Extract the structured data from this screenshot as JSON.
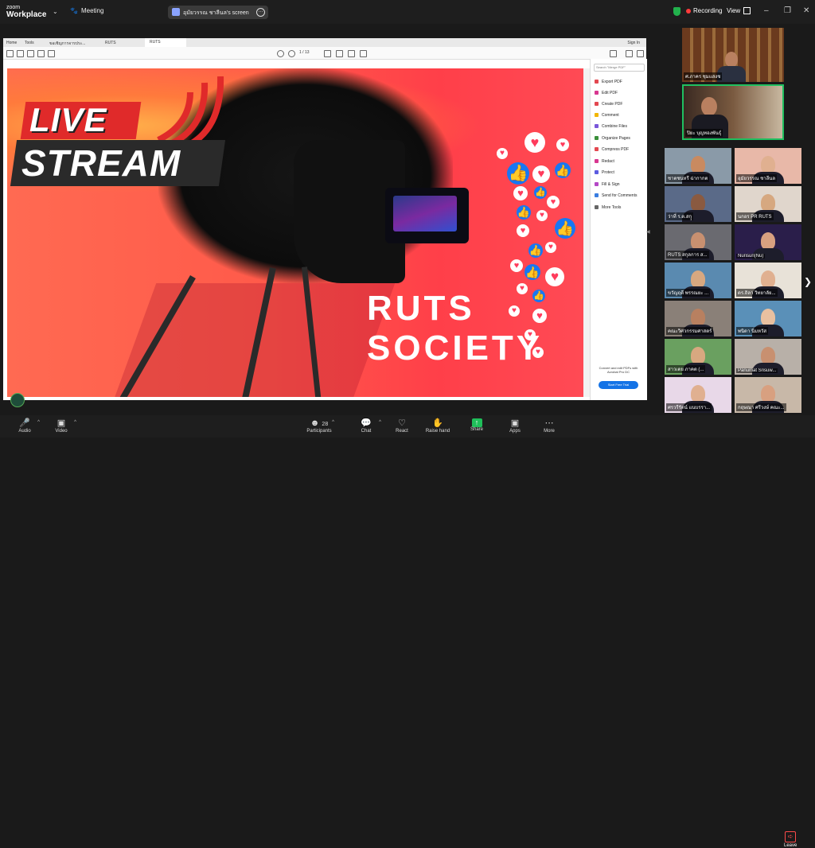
{
  "app": {
    "brand_top": "zoom",
    "brand_bottom": "Workplace",
    "meeting_label": "Meeting"
  },
  "share_banner": {
    "text": "อุมัยวรรณ ชาลีนล's screen"
  },
  "status": {
    "recording": "Recording",
    "view": "View"
  },
  "browser": {
    "tabs": [
      "Home",
      "Tools",
      "ขอเชิญการจารประ...",
      "RUTS",
      "RUTS"
    ],
    "sign_in": "Sign In",
    "page": "1 / 13"
  },
  "slide": {
    "line1": "LIVE",
    "line2": "STREAM",
    "brand1": "RUTS",
    "brand2": "SOCIETY"
  },
  "pdf_panel": {
    "search_placeholder": "Search \"Merge PDF\"",
    "items": [
      "Export PDF",
      "Edit PDF",
      "Create PDF",
      "Comment",
      "Combine Files",
      "Organize Pages",
      "Compress PDF",
      "Redact",
      "Protect",
      "Fill & Sign",
      "Send for Comments",
      "More Tools"
    ],
    "item_colors": [
      "#e34850",
      "#d83790",
      "#e34850",
      "#f2b600",
      "#7a57d9",
      "#3a8f3a",
      "#e34850",
      "#d83790",
      "#5c5ce0",
      "#b548c6",
      "#3a7de0",
      "#666666"
    ],
    "promo": "Convert and edit PDFs with Acrobat Pro DC",
    "trial_button": "Start Free Trial"
  },
  "speakers": [
    {
      "name": "ศ.ภาคร ชุมแสงช",
      "bg": "#7a4a2a"
    },
    {
      "name": "ปิยะ บุญทองพันธุ์",
      "bg": "#4a3a30"
    }
  ],
  "gallery": [
    {
      "name": "ชาตชนหรี ฉ่ากากต",
      "bg": "#8a9aa8",
      "skin": "#c98a60"
    },
    {
      "name": "อุมัยวรรณ ชาลีนล",
      "bg": "#e8b8a8",
      "skin": "#e0b090"
    },
    {
      "name": "ว่าที่ ร.ต.สกุุ",
      "bg": "#5a6a88",
      "skin": "#8a5a40"
    },
    {
      "name": "นกอร PR RUTS",
      "bg": "#e0d6cc",
      "skin": "#d6a880"
    },
    {
      "name": "RUTS สกุลการ ส...",
      "bg": "#6a6a70",
      "skin": "#c89070"
    },
    {
      "name": "Nurisun(Nu)",
      "bg": "#2a1e4a",
      "skin": "#d8a080"
    },
    {
      "name": "ขวัญฤดี พรรณยะ ...",
      "bg": "#5a8ab0",
      "skin": "#d8a880"
    },
    {
      "name": "ดร.ถิลา วิทยาลัย...",
      "bg": "#e8e2d8",
      "skin": "#e0b090"
    },
    {
      "name": "คณะวิศวกรรมศาสตร์",
      "bg": "#8a8078",
      "skin": "#b88060"
    },
    {
      "name": "พนิดา นิ่มหวัส",
      "bg": "#5a90b8",
      "skin": "#e8c0a0"
    },
    {
      "name": "สาวเตย ภาคต (...",
      "bg": "#6aa060",
      "skin": "#d8a880"
    },
    {
      "name": "Panumat Srisuw...",
      "bg": "#b8b0a8",
      "skin": "#c89070"
    },
    {
      "name": "ศรวรีรัตน์ แนบรรา...",
      "bg": "#e8d8e8",
      "skin": "#e0b090"
    },
    {
      "name": "กฤษณา ศรีวงษ์ คณะ...",
      "bg": "#c8b8a8",
      "skin": "#d8a080"
    }
  ],
  "bottom": {
    "audio": "Audio",
    "video": "Video",
    "participants": "Participants",
    "participants_count": "28",
    "chat": "Chat",
    "react": "React",
    "raise_hand": "Raise hand",
    "share": "Share",
    "apps": "Apps",
    "more": "More",
    "leave": "Leave"
  }
}
